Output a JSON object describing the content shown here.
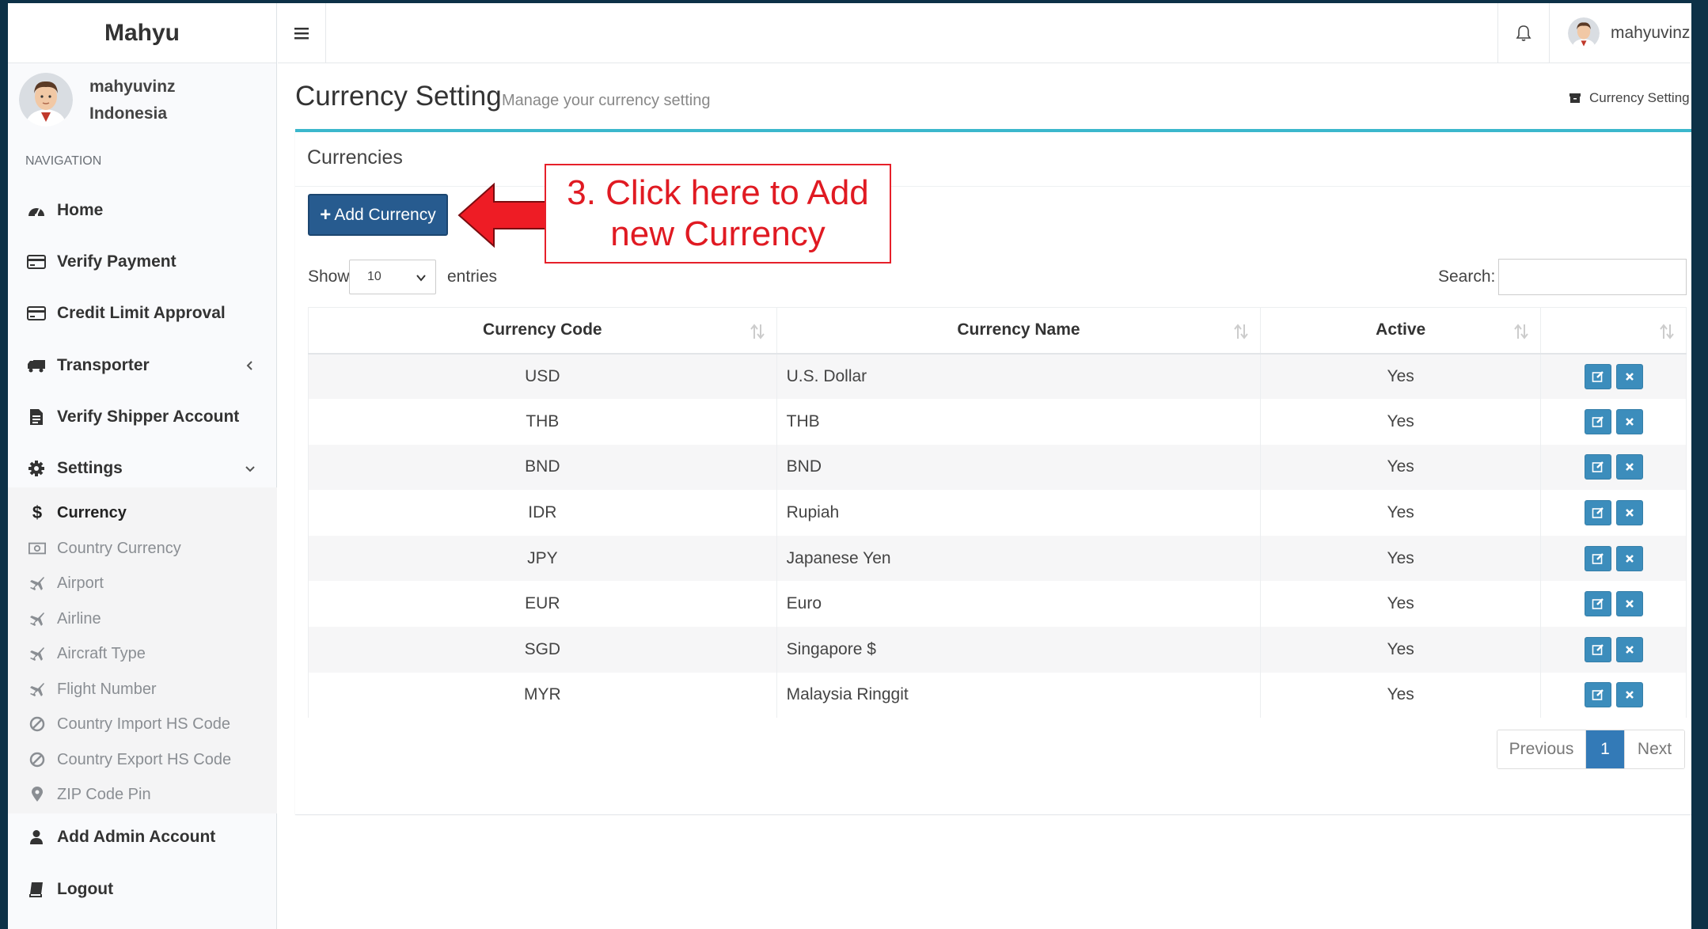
{
  "app": {
    "title": "Mahyu"
  },
  "user": {
    "name": "mahyuvinz",
    "country": "Indonesia"
  },
  "sidebar": {
    "header": "NAVIGATION",
    "items": [
      {
        "label": "Home",
        "icon": "dashboard-icon"
      },
      {
        "label": "Verify Payment",
        "icon": "credit-card-icon"
      },
      {
        "label": "Credit Limit Approval",
        "icon": "credit-card-icon"
      },
      {
        "label": "Transporter",
        "icon": "truck-icon"
      },
      {
        "label": "Verify Shipper Account",
        "icon": "file-icon"
      },
      {
        "label": "Settings",
        "icon": "gear-icon"
      },
      {
        "label": "Add Admin Account",
        "icon": "user-icon"
      },
      {
        "label": "Logout",
        "icon": "book-icon"
      }
    ],
    "settings_sub": [
      {
        "label": "Currency",
        "icon": "dollar-icon"
      },
      {
        "label": "Country Currency",
        "icon": "money-icon"
      },
      {
        "label": "Airport",
        "icon": "plane-icon"
      },
      {
        "label": "Airline",
        "icon": "plane-icon"
      },
      {
        "label": "Aircraft Type",
        "icon": "plane-icon"
      },
      {
        "label": "Flight Number",
        "icon": "plane-icon"
      },
      {
        "label": "Country Import HS Code",
        "icon": "ban-icon"
      },
      {
        "label": "Country Export HS Code",
        "icon": "ban-icon"
      },
      {
        "label": "ZIP Code Pin",
        "icon": "map-marker-icon"
      }
    ]
  },
  "topbar": {
    "user_name": "mahyuvinz"
  },
  "page": {
    "title": "Currency Setting",
    "subtitle": "Manage your currency setting",
    "breadcrumb": "Currency Setting"
  },
  "box": {
    "title": "Currencies",
    "add_button": "Add Currency"
  },
  "annotation": {
    "line1": "3. Click here to Add",
    "line2": "new Currency"
  },
  "table_controls": {
    "show_label": "Show",
    "entries_value": "10",
    "entries_label": "entries",
    "search_label": "Search:",
    "search_value": ""
  },
  "table": {
    "headers": [
      "Currency Code",
      "Currency Name",
      "Active",
      ""
    ],
    "rows": [
      {
        "code": "USD",
        "name": "U.S. Dollar",
        "active": "Yes"
      },
      {
        "code": "THB",
        "name": "THB",
        "active": "Yes"
      },
      {
        "code": "BND",
        "name": "BND",
        "active": "Yes"
      },
      {
        "code": "IDR",
        "name": "Rupiah",
        "active": "Yes"
      },
      {
        "code": "JPY",
        "name": "Japanese Yen",
        "active": "Yes"
      },
      {
        "code": "EUR",
        "name": "Euro",
        "active": "Yes"
      },
      {
        "code": "SGD",
        "name": "Singapore $",
        "active": "Yes"
      },
      {
        "code": "MYR",
        "name": "Malaysia Ringgit",
        "active": "Yes"
      }
    ]
  },
  "pagination": {
    "previous": "Previous",
    "current": "1",
    "next": "Next"
  },
  "colors": {
    "primary": "#275b8f",
    "accent": "#3bb7cc",
    "button": "#3c8dbc",
    "annotation": "#e6202a"
  }
}
